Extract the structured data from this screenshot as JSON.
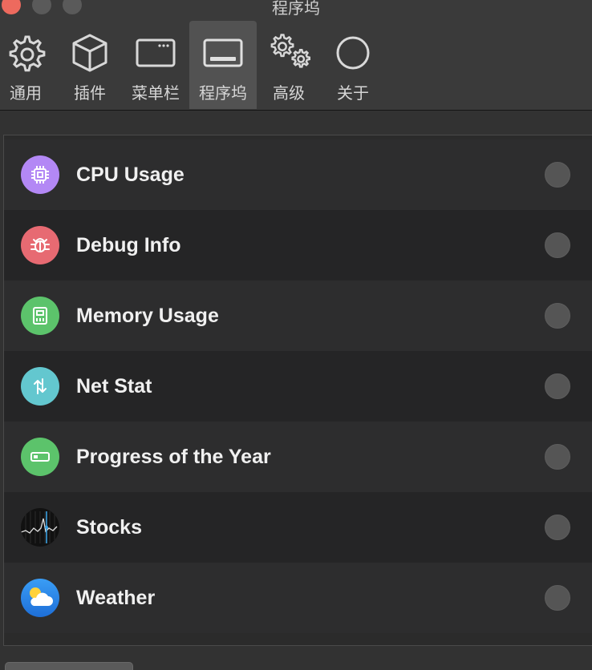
{
  "window": {
    "title": "程序坞"
  },
  "toolbar": {
    "tabs": [
      {
        "label": "通用",
        "icon": "gear-icon"
      },
      {
        "label": "插件",
        "icon": "cube-icon"
      },
      {
        "label": "菜单栏",
        "icon": "menubar-icon"
      },
      {
        "label": "程序坞",
        "icon": "dock-icon",
        "active": true
      },
      {
        "label": "高级",
        "icon": "gears-icon"
      },
      {
        "label": "关于",
        "icon": "circle-icon"
      }
    ]
  },
  "widgets": [
    {
      "label": "CPU Usage",
      "icon": "cpu-chip-icon",
      "color": "#b388f5",
      "enabled": false
    },
    {
      "label": "Debug Info",
      "icon": "bug-icon",
      "color": "#e76a72",
      "enabled": false
    },
    {
      "label": "Memory Usage",
      "icon": "memory-icon",
      "color": "#5cc36b",
      "enabled": false
    },
    {
      "label": "Net Stat",
      "icon": "up-down-arrows-icon",
      "color": "#63c7cf",
      "enabled": false
    },
    {
      "label": "Progress of the Year",
      "icon": "progress-bar-icon",
      "color": "#5cc36b",
      "enabled": false
    },
    {
      "label": "Stocks",
      "icon": "stocks-icon",
      "color": "#111111",
      "enabled": false
    },
    {
      "label": "Weather",
      "icon": "cloud-sun-icon",
      "color": "#2f8cf0",
      "enabled": false
    }
  ]
}
